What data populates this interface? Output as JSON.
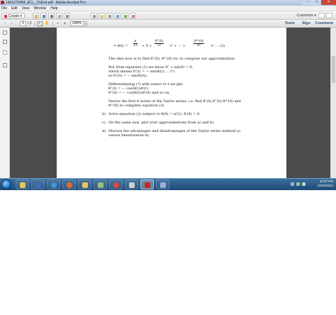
{
  "window": {
    "title": "1401272454_811__01Ex4.pdf - Adobe Acrobat Pro",
    "min_glyph": "–",
    "max_glyph": "□",
    "close_glyph": "✕"
  },
  "menu": [
    "File",
    "Edit",
    "View",
    "Window",
    "Help"
  ],
  "toolbar": {
    "create_label": "Create",
    "customize_label": "Customize",
    "icons": [
      "open-icon",
      "save-icon",
      "print-icon",
      "email-icon",
      "settings-icon",
      "comment-icon",
      "stamp-icon",
      "link-icon",
      "form-icon",
      "share-icon"
    ]
  },
  "navigation": {
    "current_page": "2",
    "total_pages": "/ 2",
    "zoom": "100%",
    "zoom_out_glyph": "−",
    "zoom_in_glyph": "+",
    "prev_glyph": "↑",
    "next_glyph": "↓",
    "dropdown_glyph": "▾"
  },
  "panels": {
    "tools": "Tools",
    "sign": "Sign",
    "comment": "Comment"
  },
  "document": {
    "equation": {
      "lhs": "⇒ θ(t) =",
      "frac1_num": "π",
      "frac1_den": "12",
      "middle": "+ 0 +",
      "frac2_num": "θ‴(0)",
      "frac2_den": "2!",
      "t2": "t² + ··· +",
      "frac3_num": "θ⁽ⁿ⁾(0)",
      "frac3_den": "n!",
      "tail": "tⁿ  ...  (3)"
    },
    "lines": [
      "The idea now is to find θ‴(0), θ⁽³⁾(0) etc to compute our approximation.",
      "But from equation (1) we know θ″ + sin(θ) = 0,",
      "which means                       θ″(t) = − sin(θ(t))   ...  (*)",
      "so                                         θ″(0) = − sin(θ(0)).",
      "Differentiating (*) with resect to t we get:",
      "θ‴(t) = − cos(θ(t))θ′(t)",
      "θ‴(0) = − cos(θ(0))θ′(0) and so on.",
      "Derive the first 6 terms of the Taylor series, i.e.  find θ″(0),θ‴(0),θ⁽⁴⁾(0) and",
      "θ⁽⁵⁾(0) to complete equation (3)"
    ],
    "items": [
      {
        "label": "b)",
        "text": "Solve equation (2) subject to θ(0) = π/12, θ′(0) = 0."
      },
      {
        "label": "c)",
        "text": "On the same axis, plot your approximations from a) and b)."
      },
      {
        "label": "d)",
        "text": "Discuss the advantages and disadvantages of the Taylor series method a)"
      },
      {
        "label": "",
        "text": "versus linearisation b)."
      }
    ]
  },
  "taskbar": {
    "apps": [
      "explorer-icon",
      "word-icon",
      "excel-icon",
      "ie-icon",
      "firefox-icon",
      "folder-icon",
      "photos-icon",
      "chrome-icon",
      "files-icon",
      "acrobat-icon",
      "media-icon"
    ],
    "clock_time": "10:27 PM",
    "clock_date": "11/02/2014"
  },
  "colors": {
    "accent": "#2c4d7c",
    "taskbar": "#1d4a78",
    "doc_bg": "#4b4b4b"
  }
}
